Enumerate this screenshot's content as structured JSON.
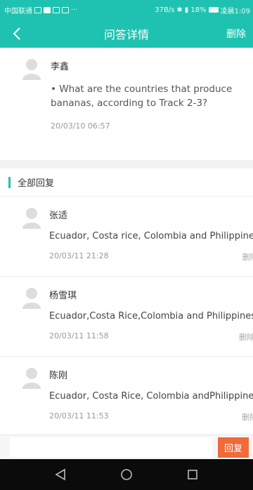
{
  "status_bar": {
    "carrier": "中国联通",
    "dots": "···",
    "speed": "37B/s",
    "battery": "18%",
    "time": "凌晨1:09"
  },
  "header": {
    "title": "问答详情",
    "delete_label": "删除",
    "back_icon": "chevron-left-icon"
  },
  "question": {
    "author": "李鑫",
    "text": "• What are the countries that produce bananas, according to Track 2-3?",
    "time": "20/03/10 06:57"
  },
  "section": {
    "title": "全部回复"
  },
  "replies": [
    {
      "author": "张适",
      "text": "Ecuador, Costa rice, Colombia and Philippines",
      "time": "20/03/11 21:28",
      "delete_label": "删除"
    },
    {
      "author": "杨雪琪",
      "text": "Ecuador,Costa Rice,Colombia and Philippines",
      "time": "20/03/11 11:58",
      "delete_label": "删除"
    },
    {
      "author": "陈刚",
      "text": "Ecuador, Costa Rice, Colombia andPhilippines",
      "time": "20/03/11 11:53",
      "delete_label": "删除"
    }
  ],
  "input_bar": {
    "placeholder": "",
    "reply_label": "回复"
  },
  "colors": {
    "accent": "#1fc2b0",
    "reply_button": "#f06a3a"
  }
}
